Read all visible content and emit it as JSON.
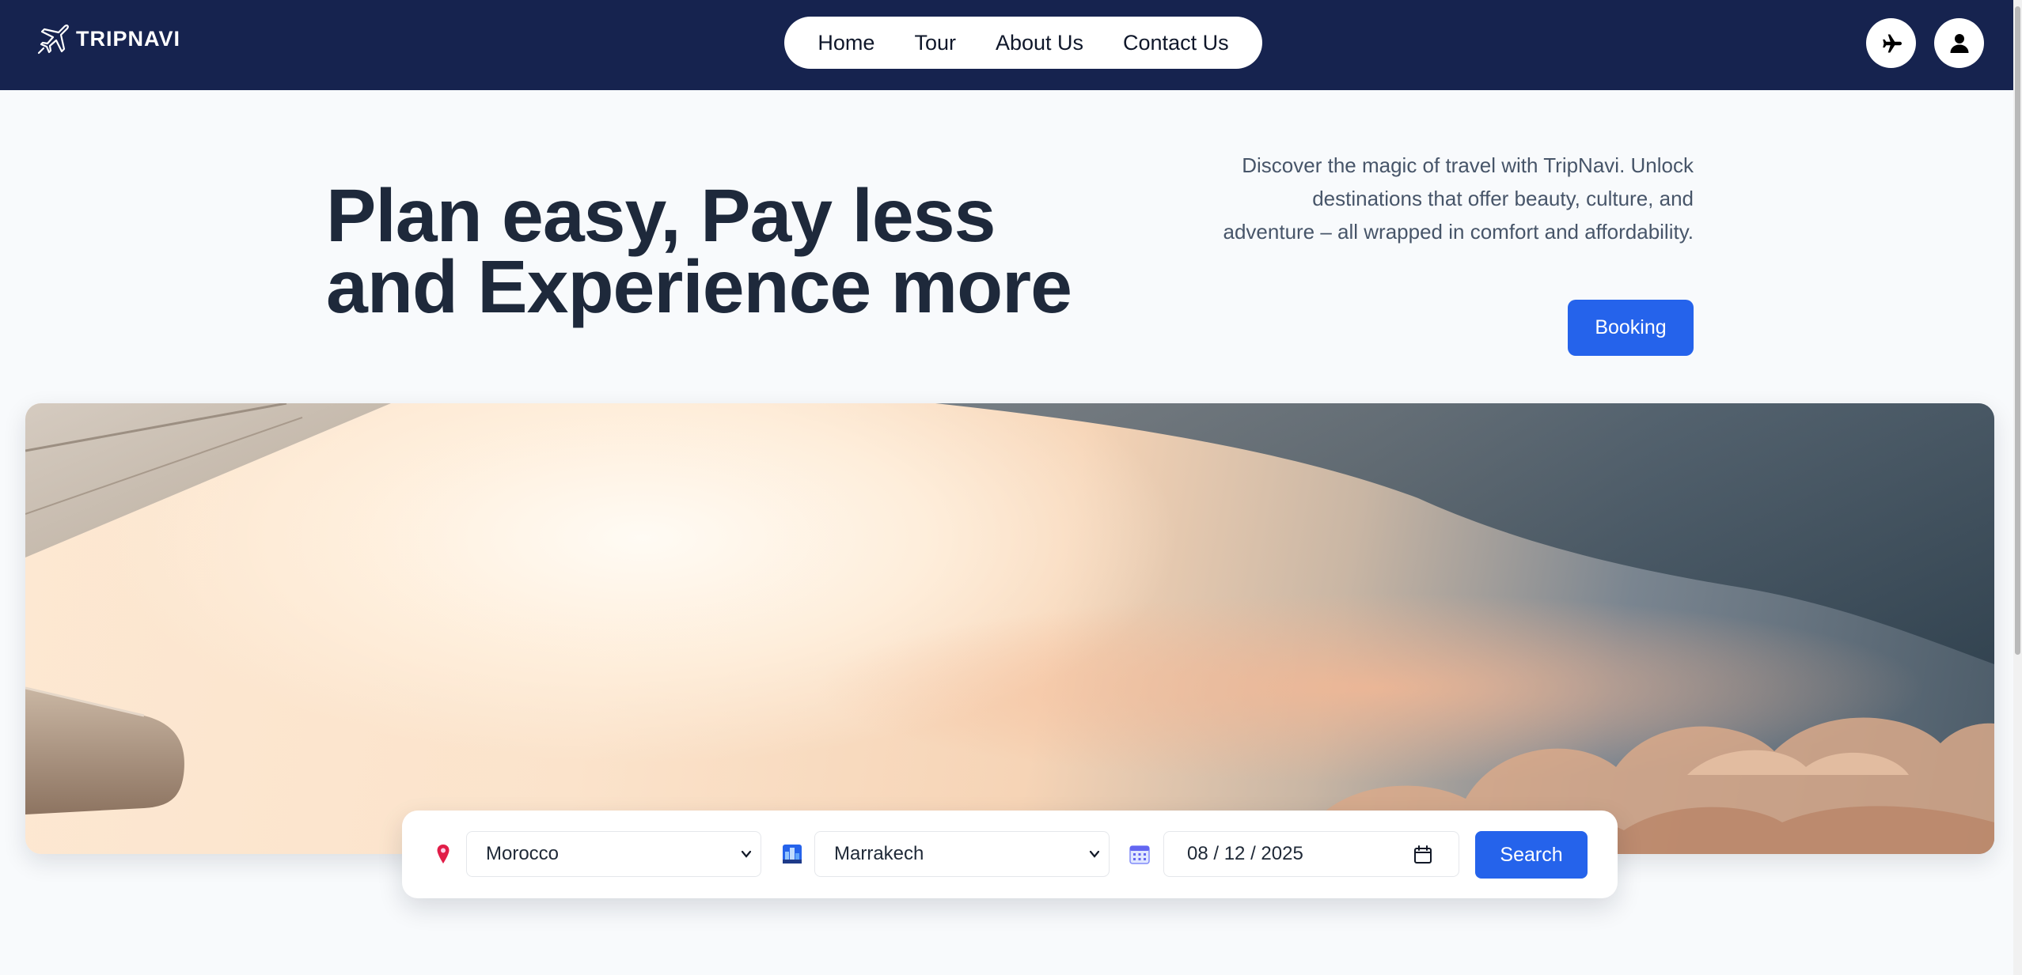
{
  "brand": {
    "name": "TRIPNAVI"
  },
  "nav": {
    "links": [
      {
        "label": "Home"
      },
      {
        "label": "Tour"
      },
      {
        "label": "About Us"
      },
      {
        "label": "Contact Us"
      }
    ],
    "actions": [
      {
        "icon": "airplane-icon"
      },
      {
        "icon": "user-icon"
      }
    ]
  },
  "hero": {
    "headline_line1": "Plan easy, Pay less",
    "headline_line2": "and Experience more",
    "description": "Discover the magic of travel with TripNavi. Unlock destinations that offer beauty, culture, and adventure – all wrapped in comfort and affordability.",
    "booking_label": "Booking"
  },
  "search": {
    "country": {
      "icon": "location-pin-icon",
      "value": "Morocco"
    },
    "city": {
      "icon": "cityscape-icon",
      "value": "Marrakech"
    },
    "date": {
      "icon": "calendar-icon",
      "value": "08 / 12 / 2025"
    },
    "search_label": "Search"
  },
  "colors": {
    "navbar": "#16234f",
    "accent": "#2563eb",
    "heading": "#1e293b",
    "body_text": "#475569",
    "background": "#f8fafc"
  }
}
